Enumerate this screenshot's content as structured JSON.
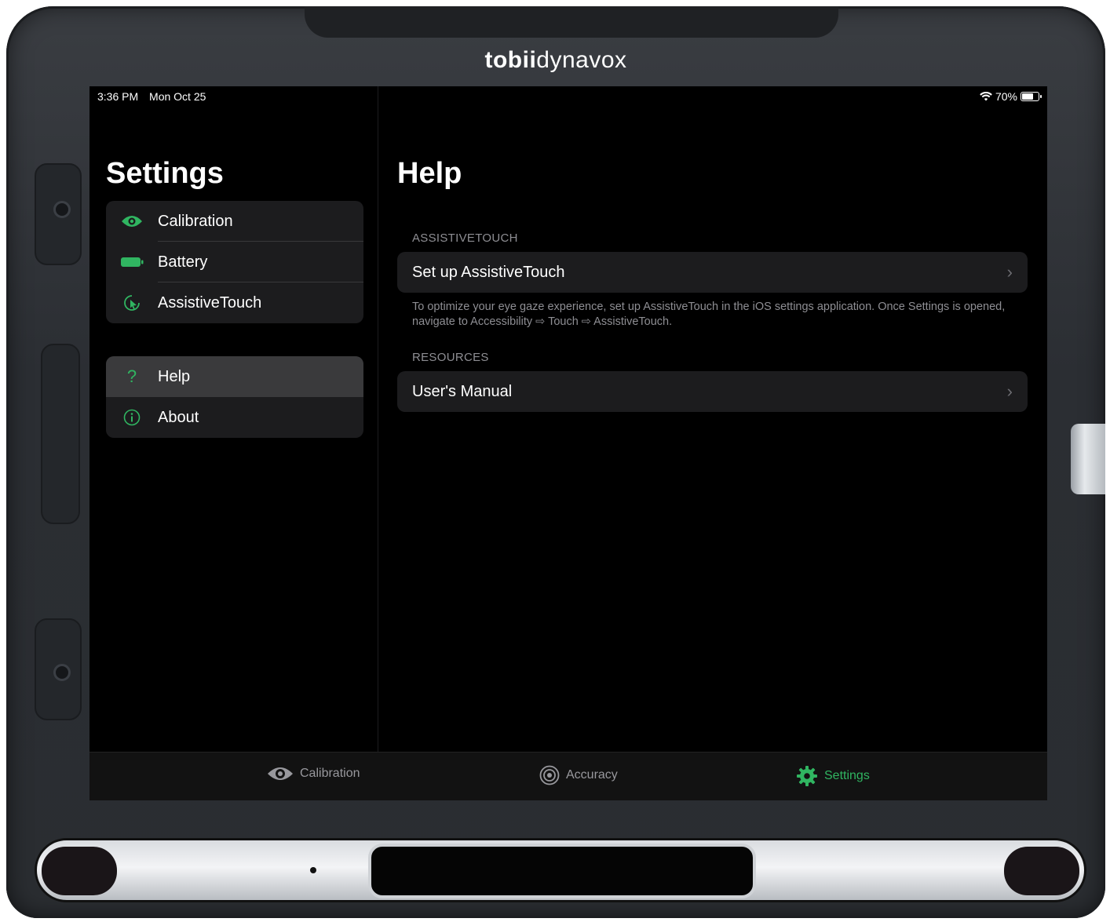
{
  "device": {
    "brand_bold": "tobii",
    "brand_light": "dynavox"
  },
  "status_bar": {
    "time": "3:36 PM",
    "date": "Mon Oct 25",
    "battery": "70%",
    "battery_level": 0.7
  },
  "master": {
    "title": "Settings",
    "group1": [
      {
        "label": "Calibration",
        "icon": "eye-icon"
      },
      {
        "label": "Battery",
        "icon": "battery-icon"
      },
      {
        "label": "AssistiveTouch",
        "icon": "assistivetouch-icon"
      }
    ],
    "group2": [
      {
        "label": "Help",
        "icon": "question-icon",
        "selected": true
      },
      {
        "label": "About",
        "icon": "info-icon"
      }
    ]
  },
  "detail": {
    "title": "Help",
    "sections": [
      {
        "header": "ASSISTIVETOUCH",
        "cell": "Set up AssistiveTouch",
        "footer": "To optimize your eye gaze experience, set up AssistiveTouch in the iOS settings application. Once Settings is opened, navigate to Accessibility ⇨ Touch ⇨ AssistiveTouch."
      },
      {
        "header": "RESOURCES",
        "cell": "User's Manual"
      }
    ],
    "chevron": "›"
  },
  "tabbar": {
    "tabs": [
      {
        "label": "Calibration",
        "icon": "eye-icon"
      },
      {
        "label": "Accuracy",
        "icon": "target-icon"
      },
      {
        "label": "Settings",
        "icon": "gear-icon",
        "active": true
      }
    ]
  },
  "colors": {
    "accent_green": "#30b561",
    "background": "#000000",
    "cell_bg": "#1c1c1e",
    "selected_bg": "#3a3a3c",
    "secondary_text": "#8e8e93"
  }
}
